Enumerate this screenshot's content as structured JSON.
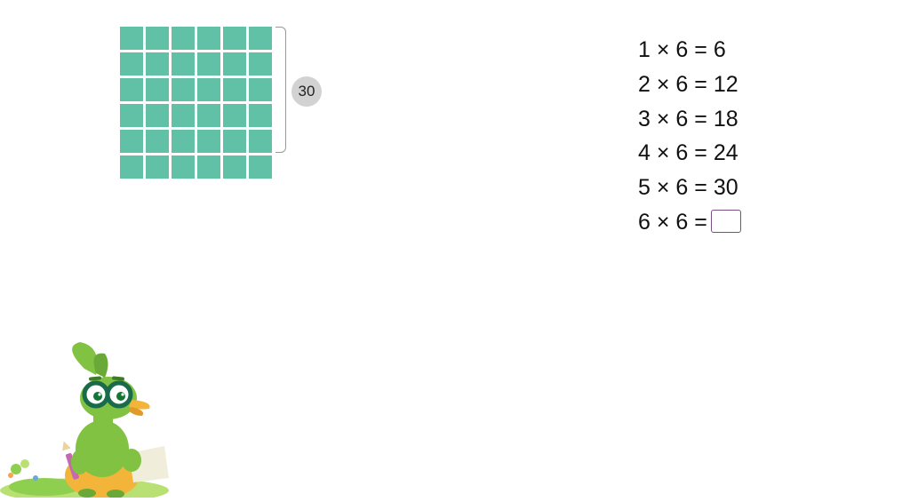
{
  "grid": {
    "rows": 6,
    "cols": 6
  },
  "bracket_rows": 5,
  "badge_value": "30",
  "equations": [
    {
      "expr": "1 × 6 =",
      "result": "6"
    },
    {
      "expr": "2 × 6 =",
      "result": "12"
    },
    {
      "expr": "3 × 6 =",
      "result": "18"
    },
    {
      "expr": "4 × 6 =",
      "result": "24"
    },
    {
      "expr": "5 × 6 =",
      "result": "30"
    },
    {
      "expr": "6 × 6 =",
      "result": ""
    }
  ],
  "colors": {
    "cell": "#60c1a7",
    "badge_bg": "#d2d2d2",
    "input_border": "#7a4d84"
  }
}
